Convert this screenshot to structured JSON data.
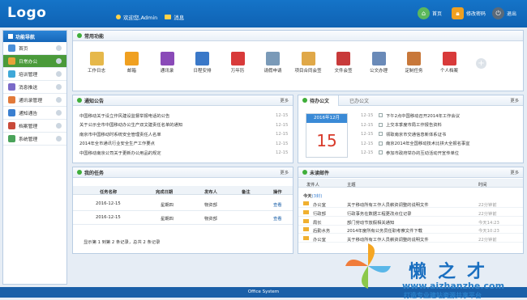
{
  "header": {
    "logo": "Logo",
    "welcome": "欢迎您,Admin",
    "messages": "消息",
    "home": "首页",
    "change_password": "修改密码",
    "logout": "退出"
  },
  "sidebar": {
    "title": "功能导航",
    "items": [
      {
        "label": "首页",
        "color": "#4a8fd8"
      },
      {
        "label": "日常办公",
        "color": "#e8a33a"
      },
      {
        "label": "培训管理",
        "color": "#3fa8d8"
      },
      {
        "label": "消息推送",
        "color": "#7a6ac8"
      },
      {
        "label": "通讯录管理",
        "color": "#e27a3a"
      },
      {
        "label": "通知通告",
        "color": "#3a7fd0"
      },
      {
        "label": "档案管理",
        "color": "#c94a3a"
      },
      {
        "label": "系统管理",
        "color": "#4aa35a"
      }
    ]
  },
  "common": {
    "title": "常用功能",
    "items": [
      {
        "label": "工作日志",
        "color": "#e6b84a"
      },
      {
        "label": "邮箱",
        "color": "#f0a020"
      },
      {
        "label": "通讯录",
        "color": "#8a4ab8"
      },
      {
        "label": "日程安排",
        "color": "#3a78c8"
      },
      {
        "label": "万年历",
        "color": "#d83a3a"
      },
      {
        "label": "请假申请",
        "color": "#7a9ab8"
      },
      {
        "label": "项目合同会签",
        "color": "#e0a848"
      },
      {
        "label": "文件会签",
        "color": "#c83a3a"
      },
      {
        "label": "公文办理",
        "color": "#6a8ab8"
      },
      {
        "label": "定制任务",
        "color": "#c8783a"
      },
      {
        "label": "个人档案",
        "color": "#d83a3a"
      }
    ],
    "add": "+"
  },
  "notice": {
    "title": "通知公告",
    "more": "更多",
    "rows": [
      {
        "text": "中国移动关于设立作风建设监督举报电话的公告",
        "date": "12-15"
      },
      {
        "text": "关于公示全市中国移动办公生产双文建责任名单的通知",
        "date": "12-15"
      },
      {
        "text": "南京市中国移动时系统安全管理责任人名单",
        "date": "12-15"
      },
      {
        "text": "2014年全市通讯行业安全生产工作要点",
        "date": "12-15"
      },
      {
        "text": "中国移动南京公司关于更新办公用品的规定",
        "date": "12-15"
      }
    ]
  },
  "todo": {
    "tab_active": "待办公文",
    "tab_other": "已办公文",
    "more": "更多",
    "calendar_month": "2016年12月",
    "calendar_day": "15",
    "rows": [
      {
        "text": "下午2点中国移动召开2014年工作会议",
        "date": "12-15"
      },
      {
        "text": "上交本季度市局工作报告资料",
        "date": "12-15"
      },
      {
        "text": "领取南京市交通信息新体系证书",
        "date": "12-15"
      },
      {
        "text": "南京2014年全国移动技术比拼大全报名事宜",
        "date": "12-15"
      },
      {
        "text": "参加市政府举办的互动活动开宣传单位",
        "date": "12-15"
      }
    ]
  },
  "tasks": {
    "title": "我的任务",
    "more": "更多",
    "headers": [
      "任务名称",
      "完成日期",
      "发布人",
      "备注",
      "操作"
    ],
    "rows": [
      {
        "name": "2016-12-15",
        "date": "星期四",
        "publisher": "物资部",
        "note": "",
        "action": "查看"
      },
      {
        "name": "2016-12-15",
        "date": "星期四",
        "publisher": "物资部",
        "note": "",
        "action": "查看"
      }
    ],
    "footer": "显示第 1 到第 2 条记录，总共 2 条记录"
  },
  "mail": {
    "title": "未读邮件",
    "more": "更多",
    "headers": [
      "发件人",
      "主题",
      "时间"
    ],
    "today_label": "今天",
    "today_count": "(3封)",
    "rows": [
      {
        "sender": "办公室",
        "subject": "关于移动所有工作人员薪资调整的说明文件",
        "time": "22分钟前"
      },
      {
        "sender": "行政部",
        "subject": "行政事务在数据工程更改点位记录",
        "time": "22分钟前"
      },
      {
        "sender": "局长",
        "subject": "部门劳动节放假相关通知",
        "time": "今天14:23"
      },
      {
        "sender": "后勤水务",
        "subject": "2014年度所有公务员任职考察文件下载",
        "time": "今天10:23"
      },
      {
        "sender": "办公室",
        "subject": "关于移动所有工作人员薪资调整的说明文件",
        "time": "22分钟前"
      }
    ]
  },
  "footer": {
    "text": "Office System"
  },
  "watermark": {
    "text1": "懒之才",
    "text2": "www.aizhanzhe.com",
    "text3": "打造专业建站资源共享平台"
  }
}
